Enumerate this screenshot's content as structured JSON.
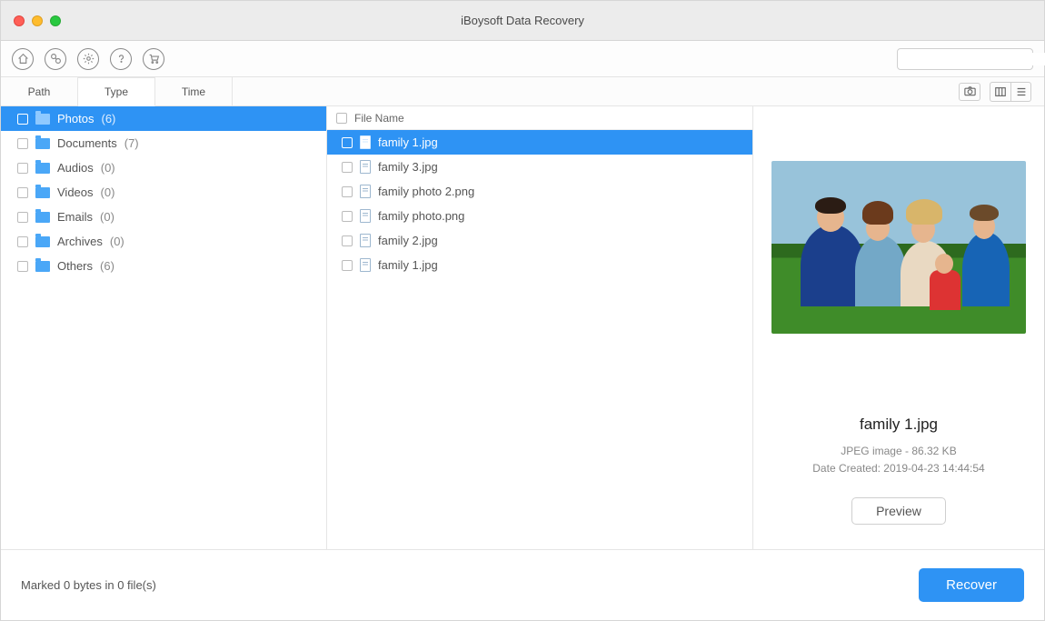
{
  "window": {
    "title": "iBoysoft Data Recovery"
  },
  "toolbar": {
    "icons": [
      "home-icon",
      "link-icon",
      "settings-icon",
      "help-icon",
      "cart-icon"
    ],
    "search_placeholder": ""
  },
  "tabs": {
    "items": [
      {
        "label": "Path",
        "active": false
      },
      {
        "label": "Type",
        "active": true
      },
      {
        "label": "Time",
        "active": false
      }
    ]
  },
  "sidebar": {
    "items": [
      {
        "label": "Photos",
        "count": "(6)",
        "selected": true
      },
      {
        "label": "Documents",
        "count": "(7)",
        "selected": false
      },
      {
        "label": "Audios",
        "count": "(0)",
        "selected": false
      },
      {
        "label": "Videos",
        "count": "(0)",
        "selected": false
      },
      {
        "label": "Emails",
        "count": "(0)",
        "selected": false
      },
      {
        "label": "Archives",
        "count": "(0)",
        "selected": false
      },
      {
        "label": "Others",
        "count": "(6)",
        "selected": false
      }
    ]
  },
  "filelist": {
    "header": "File Name",
    "rows": [
      {
        "name": "family 1.jpg",
        "selected": true
      },
      {
        "name": "family 3.jpg",
        "selected": false
      },
      {
        "name": "family photo 2.png",
        "selected": false
      },
      {
        "name": "family photo.png",
        "selected": false
      },
      {
        "name": "family 2.jpg",
        "selected": false
      },
      {
        "name": "family 1.jpg",
        "selected": false
      }
    ]
  },
  "preview": {
    "filename": "family 1.jpg",
    "type_size": "JPEG image - 86.32 KB",
    "created": "Date Created: 2019-04-23 14:44:54",
    "button": "Preview"
  },
  "footer": {
    "status": "Marked 0 bytes in 0 file(s)",
    "recover": "Recover"
  }
}
